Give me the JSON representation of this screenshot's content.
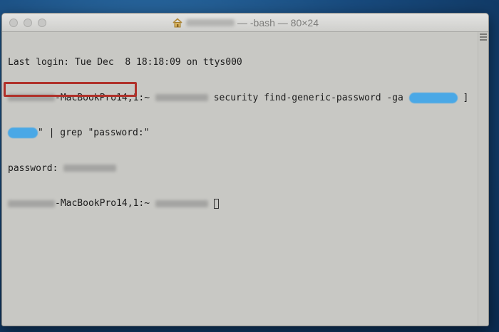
{
  "window": {
    "title": "— -bash — 80×24",
    "title_user_redacted": true
  },
  "terminal": {
    "last_login": "Last login: Tue Dec  8 18:18:09 on ttys000",
    "prompt_host": "-MacBookPro14,1:~",
    "command": "security find-generic-password -ga",
    "command_tail": "\" | grep \"password:\"",
    "output_label": "password:",
    "bracket": "]"
  },
  "colors": {
    "background": "#184a7d",
    "terminal_bg": "#c8c8c4",
    "highlight_box": "#b0312a",
    "redaction_blob": "#4aa8e6"
  },
  "icons": {
    "title_icon": "home-icon"
  }
}
